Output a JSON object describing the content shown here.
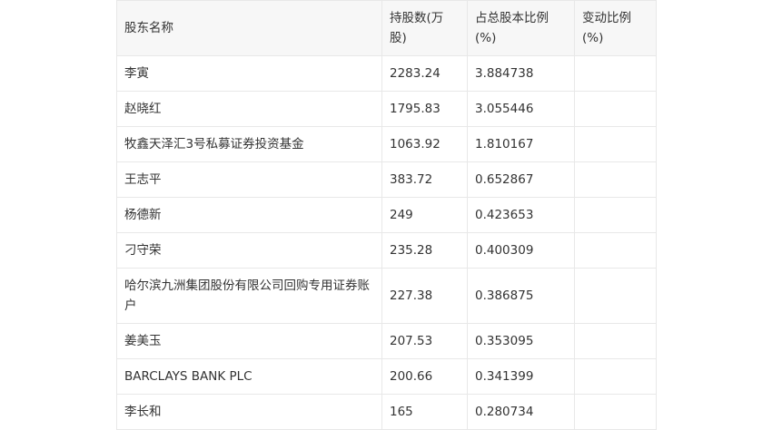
{
  "table": {
    "headers": [
      "股东名称",
      "持股数(万股)",
      "占总股本比例(%)",
      "变动比例(%)"
    ],
    "rows": [
      [
        "李寅",
        "2283.24",
        "3.884738",
        ""
      ],
      [
        "赵晓红",
        "1795.83",
        "3.055446",
        ""
      ],
      [
        "牧鑫天泽汇3号私募证券投资基金",
        "1063.92",
        "1.810167",
        ""
      ],
      [
        "王志平",
        "383.72",
        "0.652867",
        ""
      ],
      [
        "杨德新",
        "249",
        "0.423653",
        ""
      ],
      [
        "刁守荣",
        "235.28",
        "0.400309",
        ""
      ],
      [
        "哈尔滨九洲集团股份有限公司回购专用证券账户",
        "227.38",
        "0.386875",
        ""
      ],
      [
        "姜美玉",
        "207.53",
        "0.353095",
        ""
      ],
      [
        "BARCLAYS BANK PLC",
        "200.66",
        "0.341399",
        ""
      ],
      [
        "李长和",
        "165",
        "0.280734",
        ""
      ]
    ]
  }
}
